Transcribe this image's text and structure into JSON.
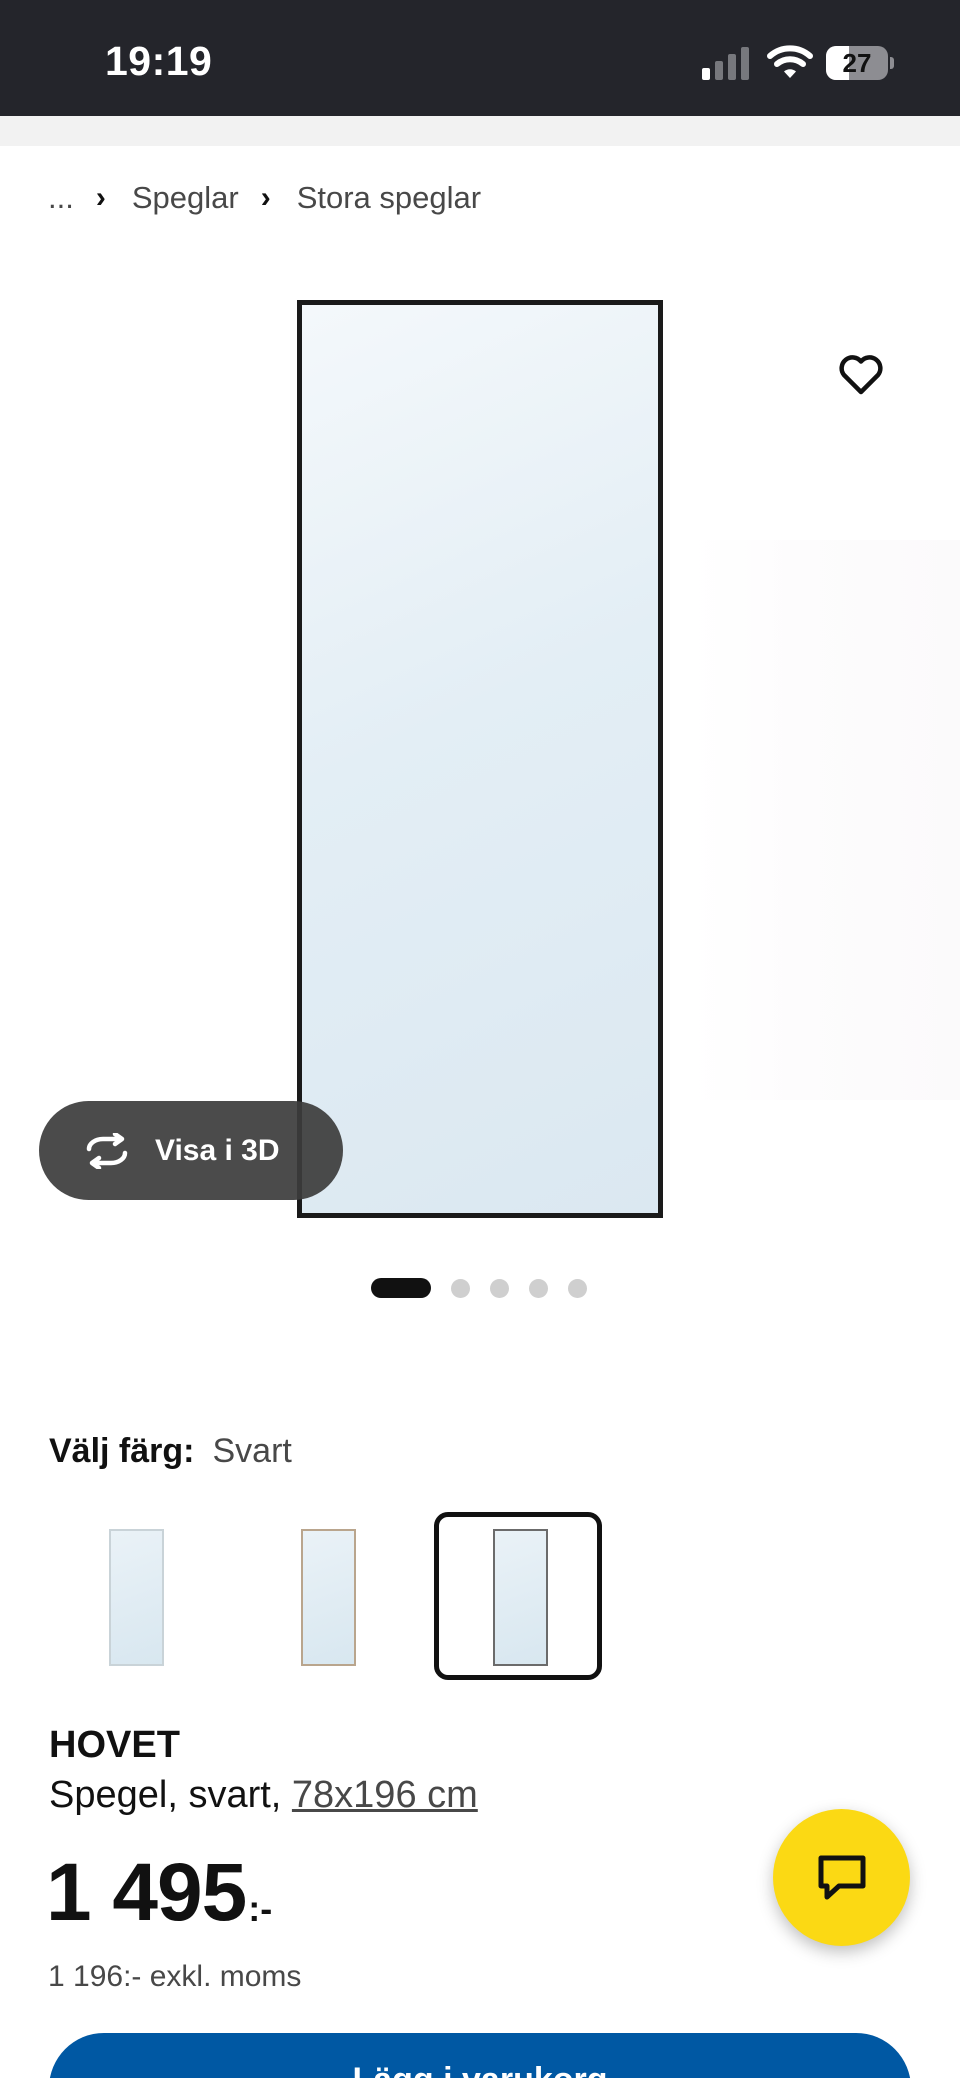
{
  "status_bar": {
    "time": "19:19",
    "battery": "27",
    "signal_icon": "cellular-signal-icon",
    "wifi_icon": "wifi-icon",
    "battery_icon": "battery-icon"
  },
  "breadcrumb": {
    "ellipsis": "...",
    "items": [
      "Speglar",
      "Stora speglar"
    ],
    "separator_icon": "chevron-right-icon"
  },
  "gallery": {
    "favorite_icon": "heart-icon",
    "view_3d_label": "Visa i 3D",
    "view_3d_icon": "rotate-3d-icon",
    "image_count": 5,
    "active_image": 1
  },
  "color": {
    "label": "Välj färg:",
    "selected": "Svart",
    "swatches": [
      {
        "name": "white-mirror",
        "frame_color": "#c9d3d8"
      },
      {
        "name": "brown-mirror",
        "frame_color": "#b9a58d"
      },
      {
        "name": "black-mirror",
        "frame_color": "#6b6b6b",
        "selected": true
      }
    ]
  },
  "product": {
    "name": "HOVET",
    "description": "Spegel, svart, ",
    "size": "78x196 cm",
    "price": "1 495",
    "price_suffix": ":-",
    "price_excl_vat": "1 196:- exkl. moms"
  },
  "chat": {
    "icon": "chat-bubble-icon",
    "color": "#fbd914"
  },
  "cart_button": {
    "label": "Lägg i varukorg",
    "color": "#0058a3"
  }
}
